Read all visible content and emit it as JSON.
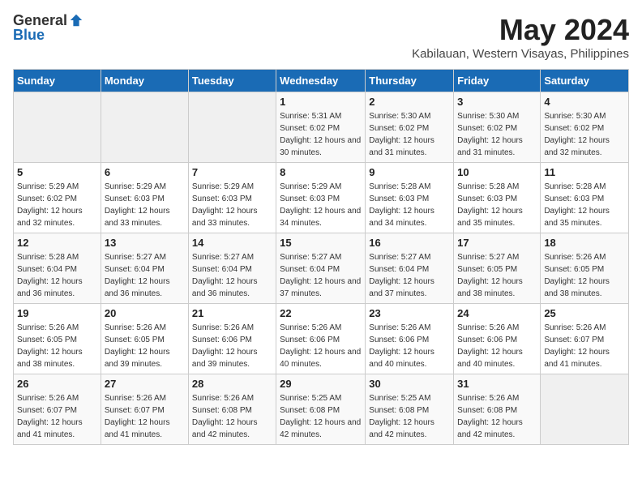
{
  "logo": {
    "general": "General",
    "blue": "Blue"
  },
  "title": {
    "month_year": "May 2024",
    "location": "Kabilauan, Western Visayas, Philippines"
  },
  "days_of_week": [
    "Sunday",
    "Monday",
    "Tuesday",
    "Wednesday",
    "Thursday",
    "Friday",
    "Saturday"
  ],
  "weeks": [
    [
      {
        "day": "",
        "info": ""
      },
      {
        "day": "",
        "info": ""
      },
      {
        "day": "",
        "info": ""
      },
      {
        "day": "1",
        "info": "Sunrise: 5:31 AM\nSunset: 6:02 PM\nDaylight: 12 hours and 30 minutes."
      },
      {
        "day": "2",
        "info": "Sunrise: 5:30 AM\nSunset: 6:02 PM\nDaylight: 12 hours and 31 minutes."
      },
      {
        "day": "3",
        "info": "Sunrise: 5:30 AM\nSunset: 6:02 PM\nDaylight: 12 hours and 31 minutes."
      },
      {
        "day": "4",
        "info": "Sunrise: 5:30 AM\nSunset: 6:02 PM\nDaylight: 12 hours and 32 minutes."
      }
    ],
    [
      {
        "day": "5",
        "info": "Sunrise: 5:29 AM\nSunset: 6:02 PM\nDaylight: 12 hours and 32 minutes."
      },
      {
        "day": "6",
        "info": "Sunrise: 5:29 AM\nSunset: 6:03 PM\nDaylight: 12 hours and 33 minutes."
      },
      {
        "day": "7",
        "info": "Sunrise: 5:29 AM\nSunset: 6:03 PM\nDaylight: 12 hours and 33 minutes."
      },
      {
        "day": "8",
        "info": "Sunrise: 5:29 AM\nSunset: 6:03 PM\nDaylight: 12 hours and 34 minutes."
      },
      {
        "day": "9",
        "info": "Sunrise: 5:28 AM\nSunset: 6:03 PM\nDaylight: 12 hours and 34 minutes."
      },
      {
        "day": "10",
        "info": "Sunrise: 5:28 AM\nSunset: 6:03 PM\nDaylight: 12 hours and 35 minutes."
      },
      {
        "day": "11",
        "info": "Sunrise: 5:28 AM\nSunset: 6:03 PM\nDaylight: 12 hours and 35 minutes."
      }
    ],
    [
      {
        "day": "12",
        "info": "Sunrise: 5:28 AM\nSunset: 6:04 PM\nDaylight: 12 hours and 36 minutes."
      },
      {
        "day": "13",
        "info": "Sunrise: 5:27 AM\nSunset: 6:04 PM\nDaylight: 12 hours and 36 minutes."
      },
      {
        "day": "14",
        "info": "Sunrise: 5:27 AM\nSunset: 6:04 PM\nDaylight: 12 hours and 36 minutes."
      },
      {
        "day": "15",
        "info": "Sunrise: 5:27 AM\nSunset: 6:04 PM\nDaylight: 12 hours and 37 minutes."
      },
      {
        "day": "16",
        "info": "Sunrise: 5:27 AM\nSunset: 6:04 PM\nDaylight: 12 hours and 37 minutes."
      },
      {
        "day": "17",
        "info": "Sunrise: 5:27 AM\nSunset: 6:05 PM\nDaylight: 12 hours and 38 minutes."
      },
      {
        "day": "18",
        "info": "Sunrise: 5:26 AM\nSunset: 6:05 PM\nDaylight: 12 hours and 38 minutes."
      }
    ],
    [
      {
        "day": "19",
        "info": "Sunrise: 5:26 AM\nSunset: 6:05 PM\nDaylight: 12 hours and 38 minutes."
      },
      {
        "day": "20",
        "info": "Sunrise: 5:26 AM\nSunset: 6:05 PM\nDaylight: 12 hours and 39 minutes."
      },
      {
        "day": "21",
        "info": "Sunrise: 5:26 AM\nSunset: 6:06 PM\nDaylight: 12 hours and 39 minutes."
      },
      {
        "day": "22",
        "info": "Sunrise: 5:26 AM\nSunset: 6:06 PM\nDaylight: 12 hours and 40 minutes."
      },
      {
        "day": "23",
        "info": "Sunrise: 5:26 AM\nSunset: 6:06 PM\nDaylight: 12 hours and 40 minutes."
      },
      {
        "day": "24",
        "info": "Sunrise: 5:26 AM\nSunset: 6:06 PM\nDaylight: 12 hours and 40 minutes."
      },
      {
        "day": "25",
        "info": "Sunrise: 5:26 AM\nSunset: 6:07 PM\nDaylight: 12 hours and 41 minutes."
      }
    ],
    [
      {
        "day": "26",
        "info": "Sunrise: 5:26 AM\nSunset: 6:07 PM\nDaylight: 12 hours and 41 minutes."
      },
      {
        "day": "27",
        "info": "Sunrise: 5:26 AM\nSunset: 6:07 PM\nDaylight: 12 hours and 41 minutes."
      },
      {
        "day": "28",
        "info": "Sunrise: 5:26 AM\nSunset: 6:08 PM\nDaylight: 12 hours and 42 minutes."
      },
      {
        "day": "29",
        "info": "Sunrise: 5:25 AM\nSunset: 6:08 PM\nDaylight: 12 hours and 42 minutes."
      },
      {
        "day": "30",
        "info": "Sunrise: 5:25 AM\nSunset: 6:08 PM\nDaylight: 12 hours and 42 minutes."
      },
      {
        "day": "31",
        "info": "Sunrise: 5:26 AM\nSunset: 6:08 PM\nDaylight: 12 hours and 42 minutes."
      },
      {
        "day": "",
        "info": ""
      }
    ]
  ]
}
